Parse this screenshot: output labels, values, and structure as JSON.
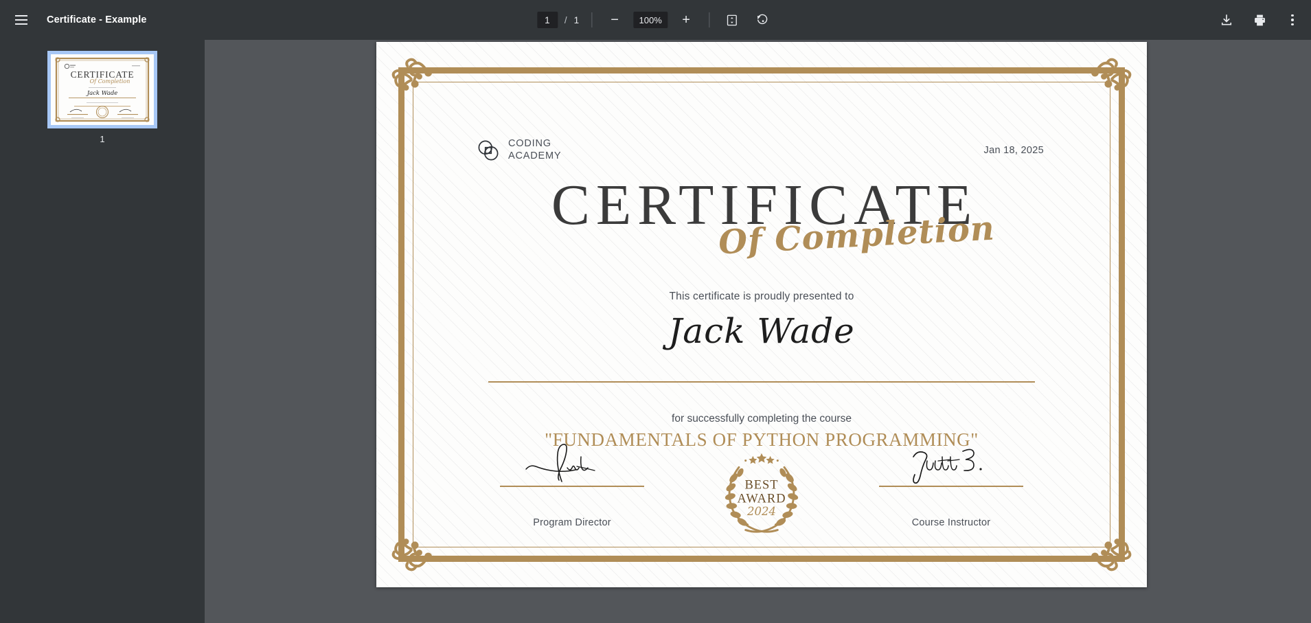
{
  "toolbar": {
    "menu_icon": "hamburger-menu-icon",
    "document_title": "Certificate - Example",
    "current_page": "1",
    "page_separator": "/",
    "total_pages": "1",
    "zoom_out_glyph": "−",
    "zoom_level": "100%",
    "zoom_in_glyph": "+",
    "fit_icon": "fit-to-page-icon",
    "rotate_icon": "rotate-clockwise-icon",
    "download_icon": "download-icon",
    "print_icon": "print-icon",
    "more_icon": "more-options-icon"
  },
  "sidebar": {
    "thumbnails": [
      {
        "page_label": "1",
        "selected": true
      }
    ]
  },
  "certificate": {
    "logo": {
      "icon": "interlocking-circles-logo-icon",
      "line1": "CODING",
      "line2": "ACADEMY"
    },
    "date": "Jan 18, 2025",
    "title_main": "CERTIFICATE",
    "title_script": "Of Completion",
    "presented_text": "This certificate is proudly presented to",
    "recipient_name": "Jack Wade",
    "for_course_text": "for successfully completing the course",
    "course_title": "\"FUNDAMENTALS OF PYTHON PROGRAMMING\"",
    "seal": {
      "line1": "BEST",
      "line2": "AWARD",
      "year": "2024",
      "stars": 5
    },
    "signatures": [
      {
        "label": "Program Director"
      },
      {
        "label": "Course Instructor"
      }
    ]
  },
  "colors": {
    "toolbar_bg": "#323639",
    "sidebar_bg": "#323639",
    "viewer_bg": "#53565a",
    "gold": "#b08d57",
    "page_bg": "#fdfdfc",
    "thumb_selected_border": "#a7c7f5",
    "title_dark": "#3b3b3b"
  }
}
